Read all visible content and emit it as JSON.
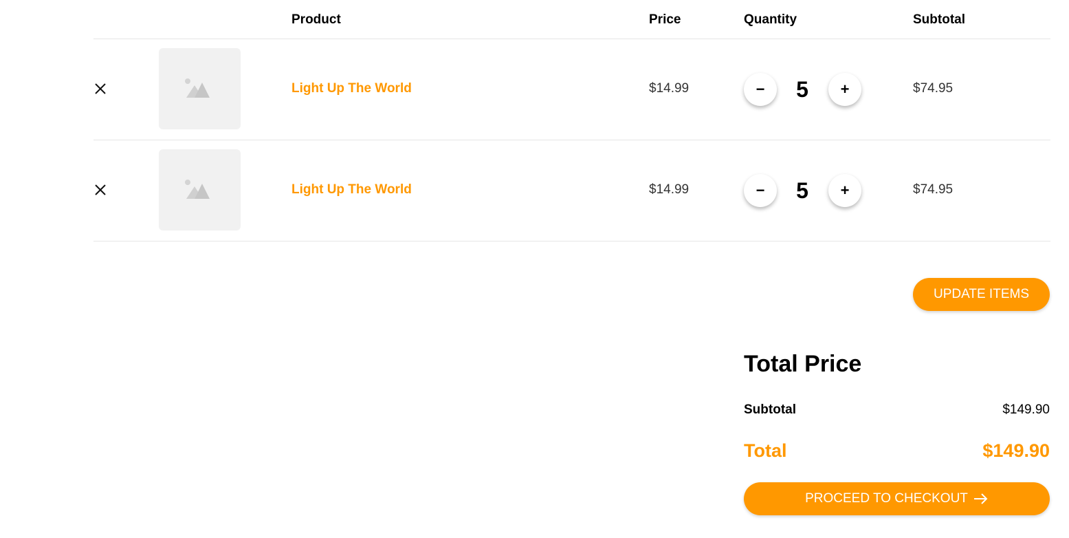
{
  "header": {
    "product": "Product",
    "price": "Price",
    "quantity": "Quantity",
    "subtotal": "Subtotal"
  },
  "items": [
    {
      "name": "Light Up The World",
      "price": "$14.99",
      "quantity": "5",
      "subtotal": "$74.95",
      "minus": "−",
      "plus": "+"
    },
    {
      "name": "Light Up The World",
      "price": "$14.99",
      "quantity": "5",
      "subtotal": "$74.95",
      "minus": "−",
      "plus": "+"
    }
  ],
  "actions": {
    "update_label": "UPDATE ITEMS",
    "checkout_label": "PROCEED TO CHECKOUT"
  },
  "totals": {
    "title": "Total Price",
    "subtotal_label": "Subtotal",
    "subtotal_value": "$149.90",
    "total_label": "Total",
    "total_value": "$149.90"
  },
  "icons": {
    "remove": "close-icon",
    "thumbnail": "image-placeholder-icon",
    "checkout_arrow": "arrow-right-icon"
  },
  "colors": {
    "accent": "#ff9800",
    "thumb_bg": "#f1f1f1",
    "divider": "#e6e6e6"
  }
}
